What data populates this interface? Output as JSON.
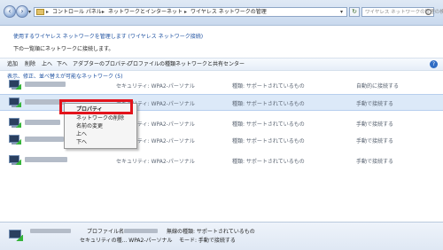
{
  "address": {
    "crumbs": [
      "コントロール パネル",
      "ネットワークとインターネット",
      "ワイヤレス ネットワークの管理"
    ]
  },
  "search": {
    "placeholder": "ワイヤレス ネットワークの管理の検索"
  },
  "header": {
    "line1": "使用するワイヤレス ネットワークを管理します (ワイヤレス ネットワーク接続)",
    "line2": "下の一覧順にネットワークに接続します。"
  },
  "toolbar": {
    "items": [
      "追加",
      "削除",
      "上へ",
      "下へ",
      "アダプターのプロパティ",
      "プロファイルの種類",
      "ネットワークと共有センター"
    ]
  },
  "list": {
    "group_label": "表示、修正、並べ替えが可能なネットワーク (5)",
    "rows": [
      {
        "security": "セキュリティ:  WPA2-パーソナル",
        "type": "種類:  サポートされているもの",
        "mode": "自動的に接続する"
      },
      {
        "security": "セキュリティ:  WPA2-パーソナル",
        "type": "種類:  サポートされているもの",
        "mode": "手動で接続する"
      },
      {
        "security": "セキュリティ:  WPA2-パーソナル",
        "type": "種類:  サポートされているもの",
        "mode": "手動で接続する"
      },
      {
        "security": "セキュリティ:  WPA2-パーソナル",
        "type": "種類:  サポートされているもの",
        "mode": "手動で接続する"
      },
      {
        "security": "セキュリティ:  WPA2-パーソナル",
        "type": "種類:  サポートされているもの",
        "mode": "手動で接続する"
      }
    ]
  },
  "context_menu": {
    "items": [
      "プロパティ",
      "ネットワークの削除",
      "名前の変更",
      "上へ",
      "下へ"
    ]
  },
  "details": {
    "profile_label": "プロファイル名:",
    "security": "セキュリティの種... WPA2-パーソナル",
    "wireless_type": "無線の種類: サポートされているもの",
    "mode": "モード: 手動で接続する"
  },
  "colors": {
    "highlight": "#e3131b",
    "link": "#1b4fa0"
  }
}
